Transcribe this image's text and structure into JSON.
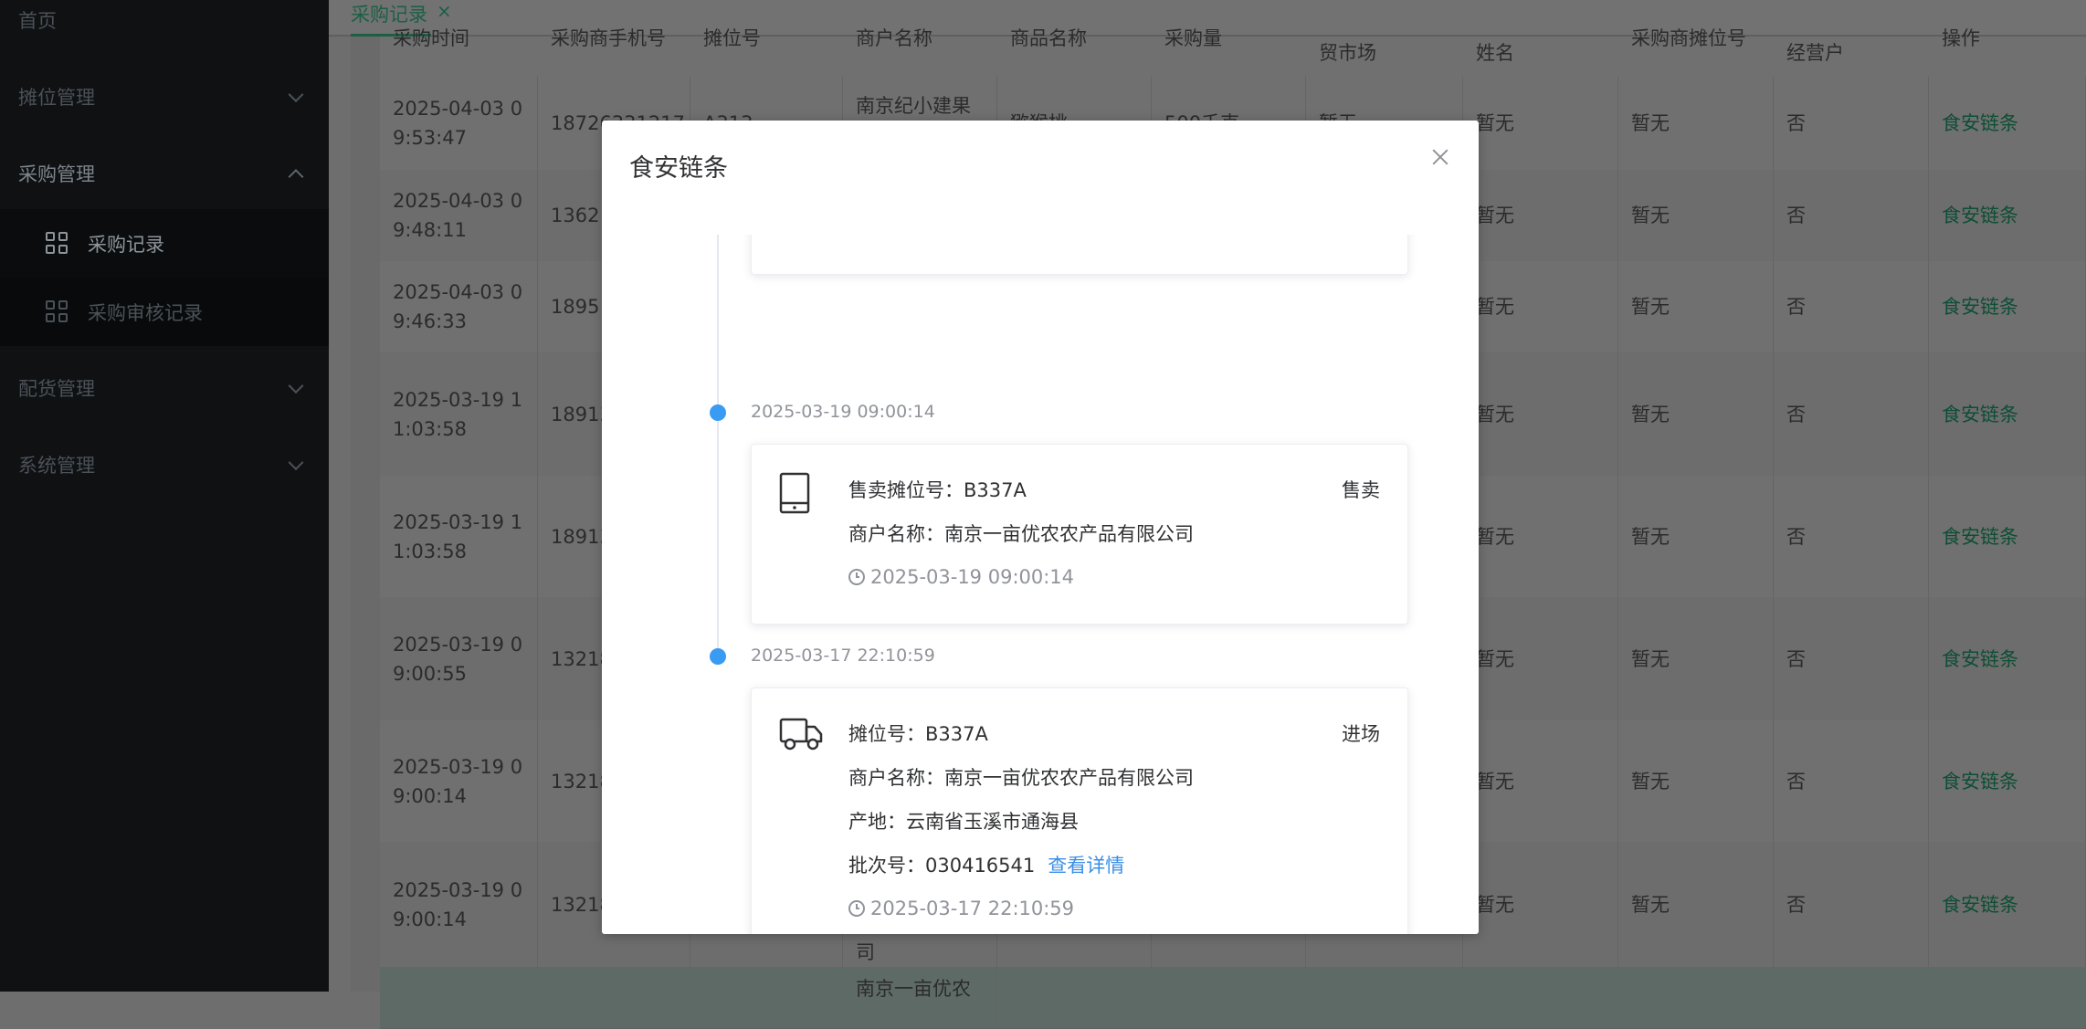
{
  "sidebar": {
    "items": [
      {
        "label": "首页"
      },
      {
        "label": "摊位管理"
      },
      {
        "label": "采购管理"
      },
      {
        "label": "配货管理"
      },
      {
        "label": "系统管理"
      }
    ],
    "sub_items": [
      {
        "label": "采购记录"
      },
      {
        "label": "采购审核记录"
      }
    ]
  },
  "tabs": [
    {
      "label": "采购记录",
      "close": "×"
    }
  ],
  "table": {
    "headers": [
      "采购时间",
      "采购商手机号",
      "摊位号",
      "商户名称",
      "商品名称",
      "采购量",
      "贸市场",
      "姓名",
      "采购商摊位号",
      "经营户",
      "操作"
    ],
    "rows": [
      {
        "time": "2025-04-03 0\n9:53:47",
        "phone": "18726331217",
        "stall": "A313",
        "merchant": "南京纪小建果",
        "product": "猕猴桃",
        "qty": "500千克",
        "market": "暂无",
        "name": "暂无",
        "buyer_stall": "暂无",
        "operator": "否",
        "action": "食安链条"
      },
      {
        "time": "2025-04-03 0\n9:48:11",
        "phone": "1362",
        "name": "暂无",
        "buyer_stall": "暂无",
        "operator": "否",
        "action": "食安链条"
      },
      {
        "time": "2025-04-03 0\n9:46:33",
        "phone": "1895",
        "name": "暂无",
        "buyer_stall": "暂无",
        "operator": "否",
        "action": "食安链条"
      },
      {
        "time": "2025-03-19 1\n1:03:58",
        "phone": "18913",
        "name": "暂无",
        "buyer_stall": "暂无",
        "operator": "否",
        "action": "食安链条"
      },
      {
        "time": "2025-03-19 1\n1:03:58",
        "phone": "18913",
        "name": "暂无",
        "buyer_stall": "暂无",
        "operator": "否",
        "action": "食安链条"
      },
      {
        "time": "2025-03-19 0\n9:00:55",
        "phone": "13218",
        "name": "暂无",
        "buyer_stall": "暂无",
        "operator": "否",
        "action": "食安链条"
      },
      {
        "time": "2025-03-19 0\n9:00:14",
        "phone": "13218",
        "name": "暂无",
        "buyer_stall": "暂无",
        "operator": "否",
        "action": "食安链条"
      },
      {
        "time": "2025-03-19 0\n9:00:14",
        "phone": "13218",
        "merchant_tail": "司",
        "name": "暂无",
        "buyer_stall": "暂无",
        "operator": "否",
        "action": "食安链条"
      }
    ],
    "tail_row": {
      "merchant": "南京一亩优农"
    }
  },
  "modal": {
    "title": "食安链条",
    "entries": [
      {
        "time": "2025-03-19 09:00:14",
        "icon": "tablet-icon",
        "tag": "售卖",
        "lines": [
          "售卖摊位号：B337A",
          "商户名称：南京一亩优农农产品有限公司"
        ],
        "stamp": "2025-03-19 09:00:14"
      },
      {
        "time": "2025-03-17 22:10:59",
        "icon": "truck-icon",
        "tag": "进场",
        "lines": [
          "摊位号：B337A",
          "商户名称：南京一亩优农农产品有限公司",
          "产地：云南省玉溪市通海县"
        ],
        "batch_label": "批次号：030416541",
        "detail_link": "查看详情",
        "stamp": "2025-03-17 22:10:59"
      }
    ]
  },
  "colors": {
    "accent": "#3a9bf2",
    "link_green": "#0e4e36",
    "sidebar_bg": "#0f1113"
  }
}
